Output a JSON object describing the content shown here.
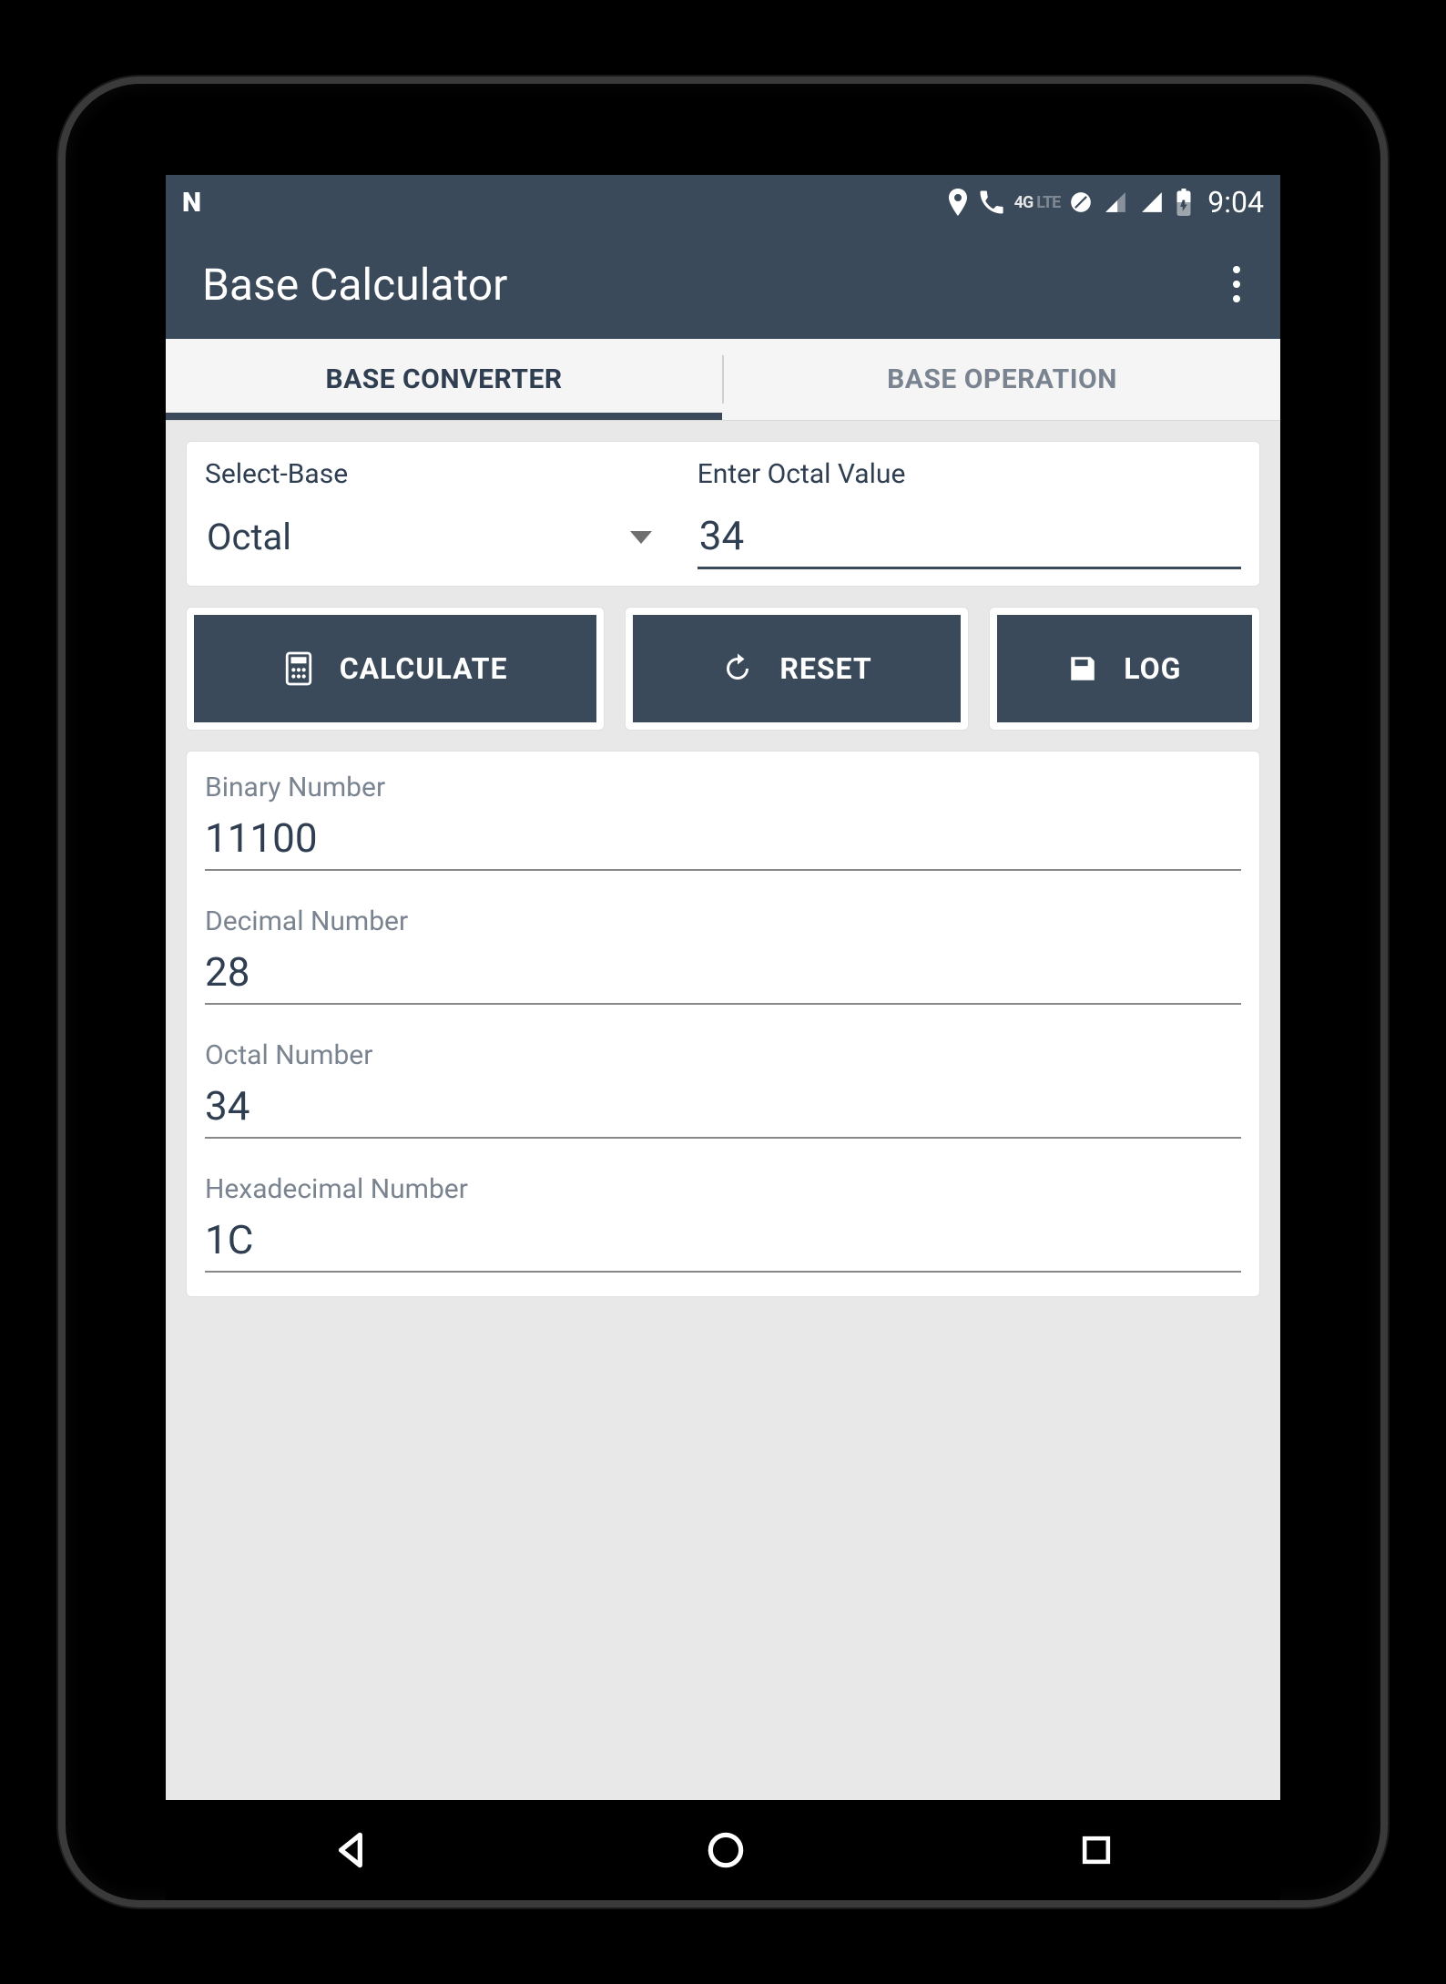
{
  "status": {
    "time": "9:04",
    "network_label": "4G",
    "network_sub": "LTE"
  },
  "appbar": {
    "title": "Base Calculator"
  },
  "tabs": {
    "converter": "BASE CONVERTER",
    "operation": "BASE OPERATION"
  },
  "input": {
    "select_label": "Select-Base",
    "select_value": "Octal",
    "value_label": "Enter Octal Value",
    "value": "34"
  },
  "buttons": {
    "calculate": "CALCULATE",
    "reset": "RESET",
    "log": "LOG"
  },
  "results": {
    "binary_label": "Binary Number",
    "binary_value": "11100",
    "decimal_label": "Decimal Number",
    "decimal_value": "28",
    "octal_label": "Octal Number",
    "octal_value": "34",
    "hex_label": "Hexadecimal Number",
    "hex_value": "1C"
  }
}
